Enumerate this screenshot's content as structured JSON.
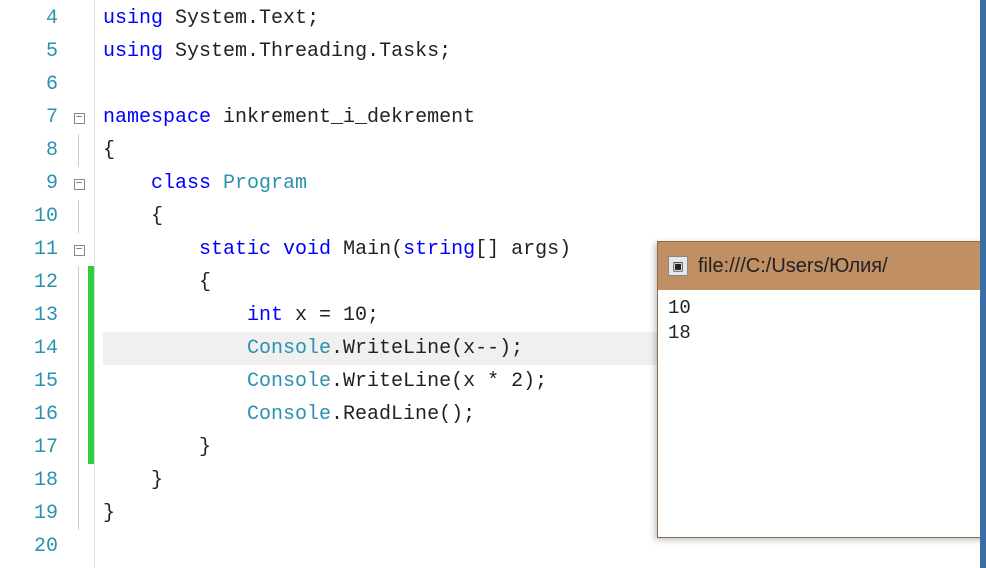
{
  "lines": [
    {
      "n": 4,
      "fold": "",
      "change": "",
      "tokens": [
        [
          "kw",
          "using"
        ],
        [
          "pln",
          " System"
        ],
        [
          "pln",
          "."
        ],
        [
          "pln",
          "Text"
        ],
        [
          "pln",
          ";"
        ]
      ]
    },
    {
      "n": 5,
      "fold": "",
      "change": "",
      "tokens": [
        [
          "kw",
          "using"
        ],
        [
          "pln",
          " System"
        ],
        [
          "pln",
          "."
        ],
        [
          "pln",
          "Threading"
        ],
        [
          "pln",
          "."
        ],
        [
          "pln",
          "Tasks"
        ],
        [
          "pln",
          ";"
        ]
      ]
    },
    {
      "n": 6,
      "fold": "",
      "change": "",
      "tokens": []
    },
    {
      "n": 7,
      "fold": "box",
      "change": "",
      "tokens": [
        [
          "kw",
          "namespace"
        ],
        [
          "pln",
          " inkrement_i_dekrement"
        ]
      ]
    },
    {
      "n": 8,
      "fold": "line",
      "change": "",
      "tokens": [
        [
          "pln",
          "{"
        ]
      ]
    },
    {
      "n": 9,
      "fold": "box",
      "change": "",
      "tokens": [
        [
          "pln",
          "    "
        ],
        [
          "kw",
          "class"
        ],
        [
          "pln",
          " "
        ],
        [
          "cls",
          "Program"
        ]
      ]
    },
    {
      "n": 10,
      "fold": "line",
      "change": "",
      "tokens": [
        [
          "pln",
          "    {"
        ]
      ]
    },
    {
      "n": 11,
      "fold": "box",
      "change": "",
      "tokens": [
        [
          "pln",
          "        "
        ],
        [
          "kw",
          "static"
        ],
        [
          "pln",
          " "
        ],
        [
          "kw",
          "void"
        ],
        [
          "pln",
          " Main("
        ],
        [
          "kw",
          "string"
        ],
        [
          "pln",
          "[] args)"
        ]
      ]
    },
    {
      "n": 12,
      "fold": "line",
      "change": "green",
      "tokens": [
        [
          "pln",
          "        {"
        ]
      ]
    },
    {
      "n": 13,
      "fold": "line",
      "change": "green",
      "tokens": [
        [
          "pln",
          "            "
        ],
        [
          "kw",
          "int"
        ],
        [
          "pln",
          " x = 10;"
        ]
      ]
    },
    {
      "n": 14,
      "fold": "line",
      "change": "green",
      "hl": true,
      "tokens": [
        [
          "pln",
          "            "
        ],
        [
          "typ",
          "Console"
        ],
        [
          "pln",
          ".WriteLine(x--);"
        ]
      ]
    },
    {
      "n": 15,
      "fold": "line",
      "change": "green",
      "tokens": [
        [
          "pln",
          "            "
        ],
        [
          "typ",
          "Console"
        ],
        [
          "pln",
          ".WriteLine(x * 2);"
        ]
      ]
    },
    {
      "n": 16,
      "fold": "line",
      "change": "green",
      "tokens": [
        [
          "pln",
          "            "
        ],
        [
          "typ",
          "Console"
        ],
        [
          "pln",
          ".ReadLine();"
        ]
      ]
    },
    {
      "n": 17,
      "fold": "line",
      "change": "green",
      "tokens": [
        [
          "pln",
          "        }"
        ]
      ]
    },
    {
      "n": 18,
      "fold": "line",
      "change": "",
      "tokens": [
        [
          "pln",
          "    }"
        ]
      ]
    },
    {
      "n": 19,
      "fold": "end",
      "change": "",
      "tokens": [
        [
          "pln",
          "}"
        ]
      ]
    },
    {
      "n": 20,
      "fold": "",
      "change": "",
      "tokens": []
    }
  ],
  "fold_box_glyph": "−",
  "console": {
    "title": "file:///C:/Users/Юлия/",
    "output": [
      "10",
      "18"
    ]
  }
}
